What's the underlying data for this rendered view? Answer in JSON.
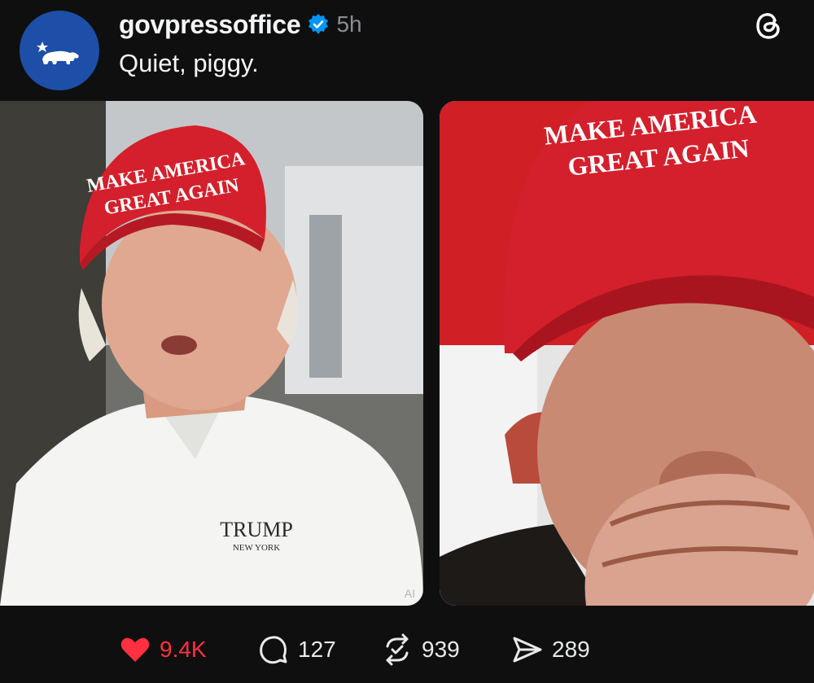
{
  "post": {
    "username": "govpressoffice",
    "timestamp": "5h",
    "text": "Quiet, piggy.",
    "avatar_icon": "california-bear-flag-icon"
  },
  "media": {
    "left": {
      "cap_line1": "MAKE AMERICA",
      "cap_line2": "GREAT AGAIN",
      "shirt_logo": "TRUMP",
      "shirt_sub": "NEW YORK",
      "badge": "AI"
    },
    "right": {
      "cap_line1": "MAKE AMERICA",
      "cap_line2": "GREAT AGAIN"
    }
  },
  "actions": {
    "likes": "9.4K",
    "replies": "127",
    "reposts": "939",
    "shares": "289"
  },
  "colors": {
    "background": "#0f0f0f",
    "like_red": "#ff3040",
    "verified_blue": "#0095f6",
    "avatar_blue": "#1d4fa8",
    "cap_red": "#d4202c"
  }
}
